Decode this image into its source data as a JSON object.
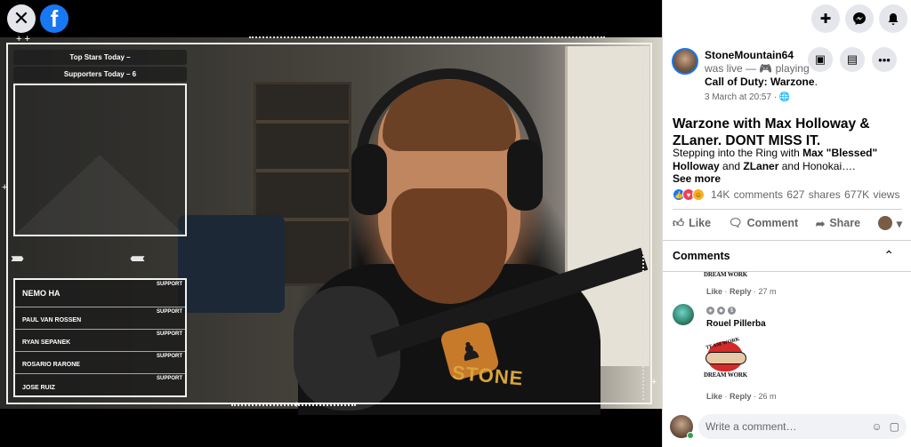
{
  "video": {
    "close_icon": "✕",
    "logo_letter": "f",
    "overlay": {
      "top_stars": "Top Stars Today –",
      "supporters": "Supporters Today – 6",
      "support_rows": [
        {
          "name": "NEMO HA",
          "tag": "SUPPORT"
        },
        {
          "name": "PAUL VAN ROSSEN",
          "tag": "SUPPORT"
        },
        {
          "name": "RYAN SEPANEK",
          "tag": "SUPPORT"
        },
        {
          "name": "ROSARIO RARONE",
          "tag": "SUPPORT"
        },
        {
          "name": "JOSE RUIZ",
          "tag": "SUPPORT"
        }
      ],
      "chevrons_right": "››››››",
      "chevrons_left": "‹‹‹‹‹‹‹"
    },
    "shirt_text": "STONE"
  },
  "header_icons": [
    "plus-icon",
    "messenger-icon",
    "bell-icon"
  ],
  "post": {
    "poster_name": "StoneMountain64",
    "status_prefix": "was live — 🎮 playing",
    "game": "Call of Duty: Warzone",
    "game_suffix": ".",
    "date": "3 March at 20:57 · 🌐",
    "title": "Warzone with Max Holloway & ZLaner. DONT MISS IT.",
    "desc_1": "Stepping into the Ring with ",
    "desc_bold_1": "Max \"Blessed\" Holloway",
    "desc_2": " and ",
    "desc_bold_2": "ZLaner",
    "desc_3": " and Honokai….",
    "see_more": "See more",
    "reactions": [
      "like",
      "love",
      "haha"
    ],
    "comments_count": "14K comments",
    "shares_count": "627 shares",
    "views_count": "677K views"
  },
  "actions": {
    "like": "Like",
    "comment": "Comment",
    "share": "Share"
  },
  "comments": {
    "header": "Comments",
    "items": [
      {
        "sticker_text": "DREAM WORK",
        "like": "Like",
        "reply": "Reply",
        "time": "27 m"
      },
      {
        "name": "Rouel Pillerba",
        "sticker_top": "TEAM WORK",
        "sticker_bottom": "DREAM WORK",
        "like": "Like",
        "reply": "Reply",
        "time": "26 m"
      }
    ],
    "input_placeholder": "Write a comment…"
  },
  "colors": {
    "facebook_blue": "#1877f2",
    "panel_bg": "#ffffff",
    "muted_text": "#65676b"
  }
}
